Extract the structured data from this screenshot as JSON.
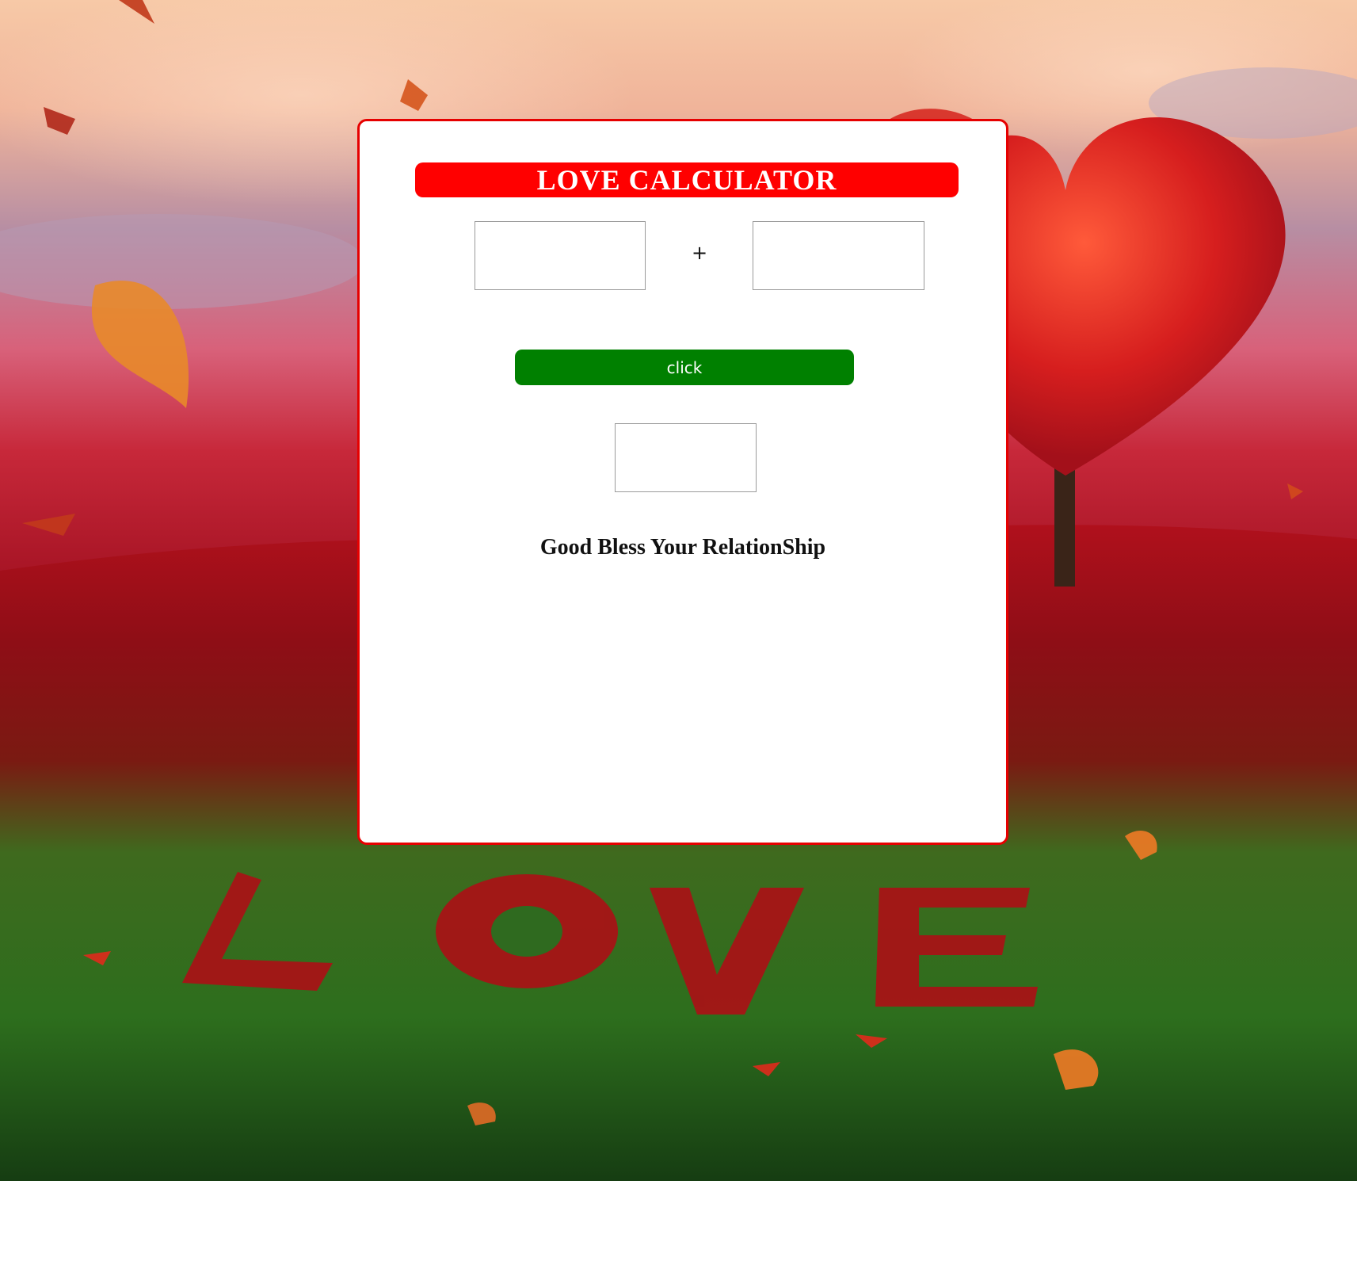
{
  "app": {
    "title": "LOVE CALCULATOR",
    "plus_sign": "+",
    "button_label": "click",
    "blessing": "Good Bless Your RelationShip"
  },
  "inputs": {
    "first_name_value": "",
    "second_name_value": "",
    "result_value": ""
  },
  "background": {
    "ground_text": "LOVE"
  },
  "colors": {
    "title_bg": "#ff0000",
    "card_border": "#e60000",
    "button_bg": "#008000",
    "button_text": "#ffffff"
  }
}
